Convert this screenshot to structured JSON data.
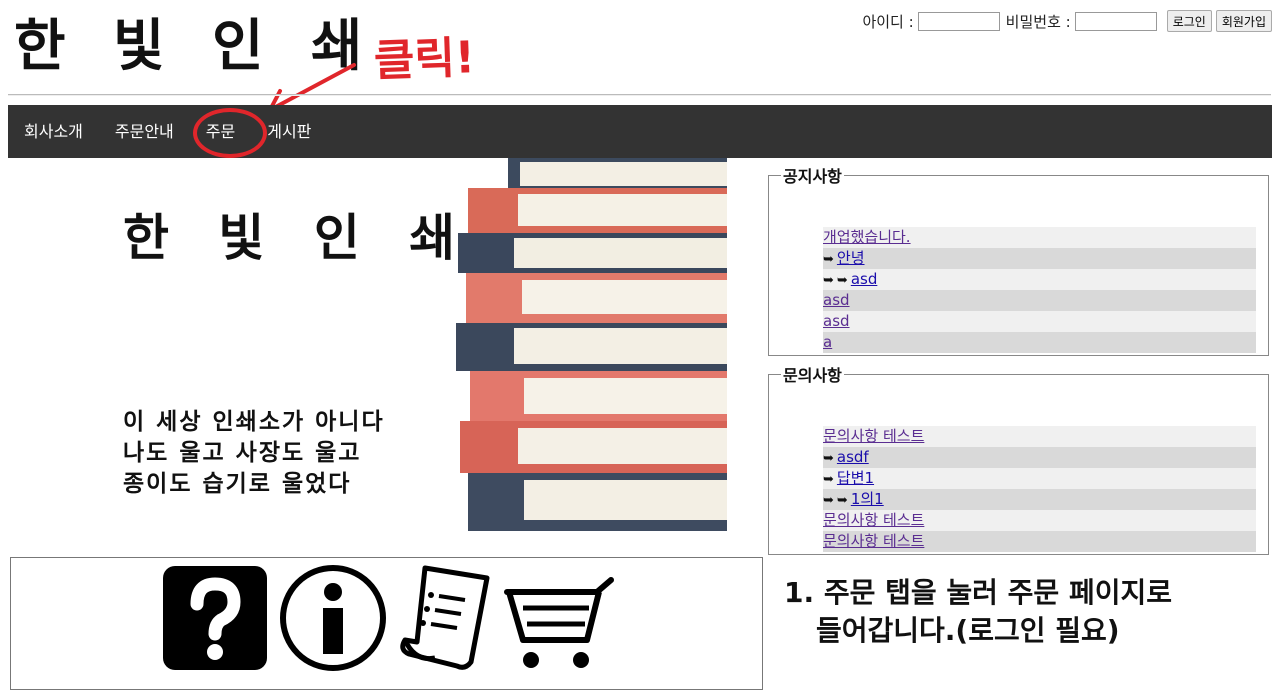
{
  "header": {
    "logo": "한 빛 인 쇄",
    "login": {
      "id_label": "아이디 :",
      "pw_label": "비밀번호 :",
      "login_button": "로그인",
      "signup_button": "회원가입"
    }
  },
  "annotation": {
    "callout": "클릭!",
    "color": "#e0262b"
  },
  "nav": {
    "items": [
      "회사소개",
      "주문안내",
      "주문",
      "게시판"
    ]
  },
  "banner": {
    "title": "한 빛 인 쇄",
    "slogan": [
      "이 세상 인쇄소가 아니다",
      "나도 울고 사장도 울고",
      "종이도 습기로 울었다"
    ]
  },
  "notice": {
    "legend": "공지사항",
    "items": [
      {
        "text": "개업했습니다.",
        "depth": 0
      },
      {
        "text": "안녕",
        "depth": 1
      },
      {
        "text": "asd",
        "depth": 2
      },
      {
        "text": "asd",
        "depth": 0
      },
      {
        "text": "asd",
        "depth": 0
      },
      {
        "text": "a",
        "depth": 0
      }
    ]
  },
  "qna": {
    "legend": "문의사항",
    "items": [
      {
        "text": "문의사항 테스트",
        "depth": 0
      },
      {
        "text": "asdf",
        "depth": 1
      },
      {
        "text": "답변1",
        "depth": 1
      },
      {
        "text": "1의1",
        "depth": 2
      },
      {
        "text": "문의사항 테스트",
        "depth": 0
      },
      {
        "text": "문의사항 테스트",
        "depth": 0
      }
    ]
  },
  "icons": [
    "question-icon",
    "info-icon",
    "document-icon",
    "cart-icon"
  ],
  "instruction": {
    "line1": "1. 주문 탭을 눌러 주문 페이지로",
    "line2": "들어갑니다.(로그인 필요)"
  },
  "colors": {
    "navbar": "#333333",
    "link": "#1a0dab",
    "visited_link": "#5a2d91",
    "annotation": "#e0262b"
  }
}
